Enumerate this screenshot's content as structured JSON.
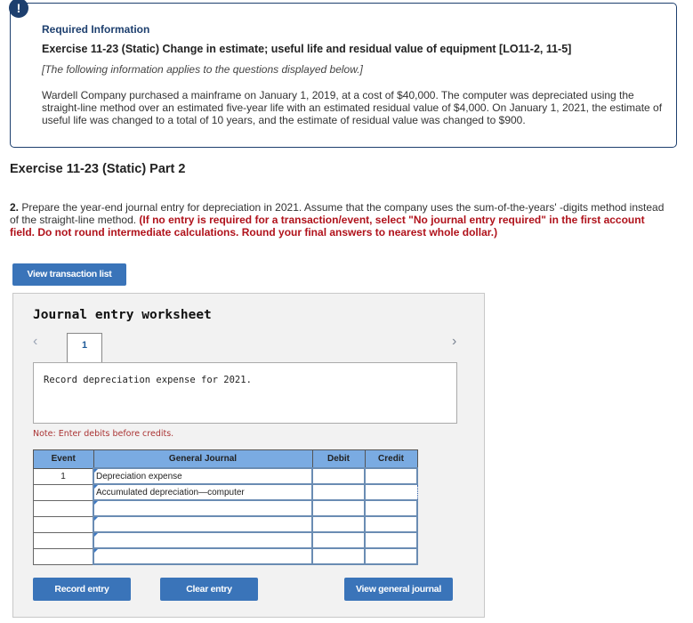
{
  "info": {
    "badge": "!",
    "heading": "Required Information",
    "exercise_title": "Exercise 11-23 (Static) Change in estimate; useful life and residual value of equipment [LO11-2, 11-5]",
    "subtitle": "[The following information applies to the questions displayed below.]",
    "body": "Wardell Company purchased a mainframe on January 1, 2019, at a cost of $40,000. The computer was depreciated using the straight-line method over an estimated five-year life with an estimated residual value of $4,000. On January 1, 2021, the estimate of useful life was changed to a total of 10 years, and the estimate of residual value was changed to $900."
  },
  "part": {
    "title": "Exercise 11-23 (Static) Part 2",
    "question_number": "2.",
    "question_text": " Prepare the year-end journal entry for depreciation in 2021. Assume that the company uses the sum-of-the-years' -digits method instead of the straight-line method. ",
    "instruction": "(If no entry is required for a transaction/event, select \"No journal entry required\" in the first account field. Do not round intermediate calculations. Round your final answers to nearest whole dollar.)"
  },
  "buttons": {
    "view_transaction_list": "View transaction list",
    "record_entry": "Record entry",
    "clear_entry": "Clear entry",
    "view_general_journal": "View general journal"
  },
  "worksheet": {
    "title": "Journal entry worksheet",
    "prev_icon": "‹",
    "next_icon": "›",
    "active_tab": "1",
    "description": "Record depreciation expense for 2021.",
    "note": "Note: Enter debits before credits.",
    "columns": [
      "Event",
      "General Journal",
      "Debit",
      "Credit"
    ],
    "rows": [
      {
        "event": "1",
        "account": "Depreciation expense",
        "debit": "",
        "credit": ""
      },
      {
        "event": "",
        "account": "Accumulated depreciation—computer",
        "debit": "",
        "credit": ""
      },
      {
        "event": "",
        "account": "",
        "debit": "",
        "credit": ""
      },
      {
        "event": "",
        "account": "",
        "debit": "",
        "credit": ""
      },
      {
        "event": "",
        "account": "",
        "debit": "",
        "credit": ""
      },
      {
        "event": "",
        "account": "",
        "debit": "",
        "credit": ""
      }
    ]
  },
  "colors": {
    "brand_navy": "#1d3f6e",
    "button_blue": "#3a74b9",
    "header_blue": "#7aabe2",
    "instruction_red": "#b0121b"
  }
}
